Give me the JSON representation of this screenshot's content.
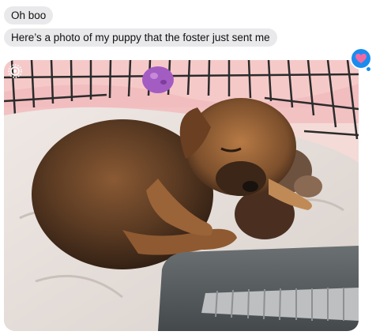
{
  "messages": [
    {
      "text": "Oh boo"
    },
    {
      "text": "Here’s a photo of my puppy that the foster just sent me"
    }
  ],
  "photo": {
    "subject": "puppy-sleeping-in-crate",
    "has_live_badge": true
  },
  "tapback": {
    "icon": "heart-icon",
    "color": "#1a8cf0",
    "heart_color": "#f06aa3"
  },
  "colors": {
    "received_bubble": "#e9e9eb",
    "text": "#111111"
  }
}
